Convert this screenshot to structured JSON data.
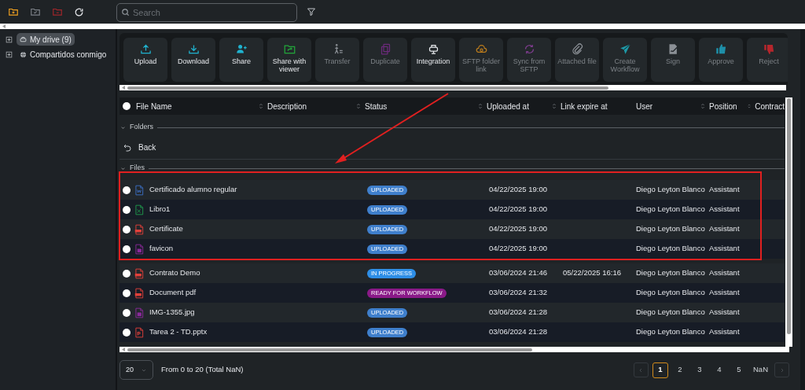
{
  "topbar": {
    "search": {
      "placeholder": "Search"
    }
  },
  "sidebar": {
    "items": [
      {
        "label": "My drive (9)",
        "kind": "drive",
        "selected": true,
        "expanded": false
      },
      {
        "label": "Compartidos conmigo",
        "kind": "shared",
        "selected": false,
        "expanded": false
      }
    ]
  },
  "actions": [
    {
      "label": "Upload",
      "kind": "upload",
      "disabled": false
    },
    {
      "label": "Download",
      "kind": "download",
      "disabled": false
    },
    {
      "label": "Share",
      "kind": "share",
      "disabled": false
    },
    {
      "label": "Share with viewer",
      "kind": "share_viewer",
      "disabled": false
    },
    {
      "label": "Transfer",
      "kind": "transfer",
      "disabled": true
    },
    {
      "label": "Duplicate",
      "kind": "duplicate",
      "disabled": true
    },
    {
      "label": "Integration",
      "kind": "integration",
      "disabled": false
    },
    {
      "label": "SFTP folder link",
      "kind": "sftp",
      "disabled": true
    },
    {
      "label": "Sync from SFTP",
      "kind": "sync",
      "disabled": true
    },
    {
      "label": "Attached file",
      "kind": "attach",
      "disabled": true
    },
    {
      "label": "Create Workflow",
      "kind": "workflow",
      "disabled": true
    },
    {
      "label": "Sign",
      "kind": "sign",
      "disabled": true
    },
    {
      "label": "Approve",
      "kind": "approve",
      "disabled": true
    },
    {
      "label": "Reject",
      "kind": "reject",
      "disabled": true
    }
  ],
  "table": {
    "select_all": {
      "checked": false
    },
    "columns": [
      {
        "label": "File Name",
        "sortable": false
      },
      {
        "label": "Description",
        "sortable": true
      },
      {
        "label": "Status",
        "sortable": true
      },
      {
        "label": "Uploaded at",
        "sortable": true
      },
      {
        "label": "Link expire at",
        "sortable": true
      },
      {
        "label": "User",
        "sortable": false
      },
      {
        "label": "Position",
        "sortable": true
      },
      {
        "label": "Contract",
        "sortable": true
      }
    ],
    "folders": {
      "label": "Folders",
      "expanded": true
    },
    "back": {
      "label": "Back"
    },
    "files": {
      "label": "Files",
      "expanded": true
    },
    "rows": [
      {
        "name": "Certificado alumno regular",
        "kind": "word",
        "status": "UPLOADED",
        "color": "#3f7fcc",
        "uploaded_at": "04/22/2025 19:00",
        "link_expire_at": "",
        "user": "Diego Leyton Blanco",
        "position": "Assistant",
        "checked": false
      },
      {
        "name": "Libro1",
        "kind": "excel",
        "status": "UPLOADED",
        "color": "#3f7fcc",
        "uploaded_at": "04/22/2025 19:00",
        "link_expire_at": "",
        "user": "Diego Leyton Blanco",
        "position": "Assistant",
        "checked": false
      },
      {
        "name": "Certificate",
        "kind": "pdf",
        "status": "UPLOADED",
        "color": "#3f7fcc",
        "uploaded_at": "04/22/2025 19:00",
        "link_expire_at": "",
        "user": "Diego Leyton Blanco",
        "position": "Assistant",
        "checked": false
      },
      {
        "name": "favicon",
        "kind": "image",
        "status": "UPLOADED",
        "color": "#3f7fcc",
        "uploaded_at": "04/22/2025 19:00",
        "link_expire_at": "",
        "user": "Diego Leyton Blanco",
        "position": "Assistant",
        "checked": false
      },
      {
        "name": "Contrato Demo",
        "kind": "pdf",
        "status": "IN PROGRESS",
        "color": "#2e8ee6",
        "uploaded_at": "03/06/2024 21:46",
        "link_expire_at": "05/22/2025 16:16",
        "user": "Diego Leyton Blanco",
        "position": "Assistant",
        "checked": false
      },
      {
        "name": "Document pdf",
        "kind": "pdf",
        "status": "READY FOR WORKFLOW",
        "color": "#8a1a88",
        "uploaded_at": "03/06/2024 21:32",
        "link_expire_at": "",
        "user": "Diego Leyton Blanco",
        "position": "Assistant",
        "checked": false
      },
      {
        "name": "IMG-1355.jpg",
        "kind": "image",
        "status": "UPLOADED",
        "color": "#3f7fcc",
        "uploaded_at": "03/06/2024 21:28",
        "link_expire_at": "",
        "user": "Diego Leyton Blanco",
        "position": "Assistant",
        "checked": false
      },
      {
        "name": "Tarea 2 - TD.pptx",
        "kind": "ppt",
        "status": "UPLOADED",
        "color": "#3f7fcc",
        "uploaded_at": "03/06/2024 21:28",
        "link_expire_at": "",
        "user": "Diego Leyton Blanco",
        "position": "Assistant",
        "checked": false
      }
    ]
  },
  "footer": {
    "page_size": "20",
    "summary": "From 0 to 20 (Total NaN)",
    "pages": [
      {
        "label": "1",
        "selected": true
      },
      {
        "label": "2",
        "selected": false
      },
      {
        "label": "3",
        "selected": false
      },
      {
        "label": "4",
        "selected": false
      },
      {
        "label": "5",
        "selected": false
      },
      {
        "label": "NaN",
        "selected": false
      }
    ]
  }
}
